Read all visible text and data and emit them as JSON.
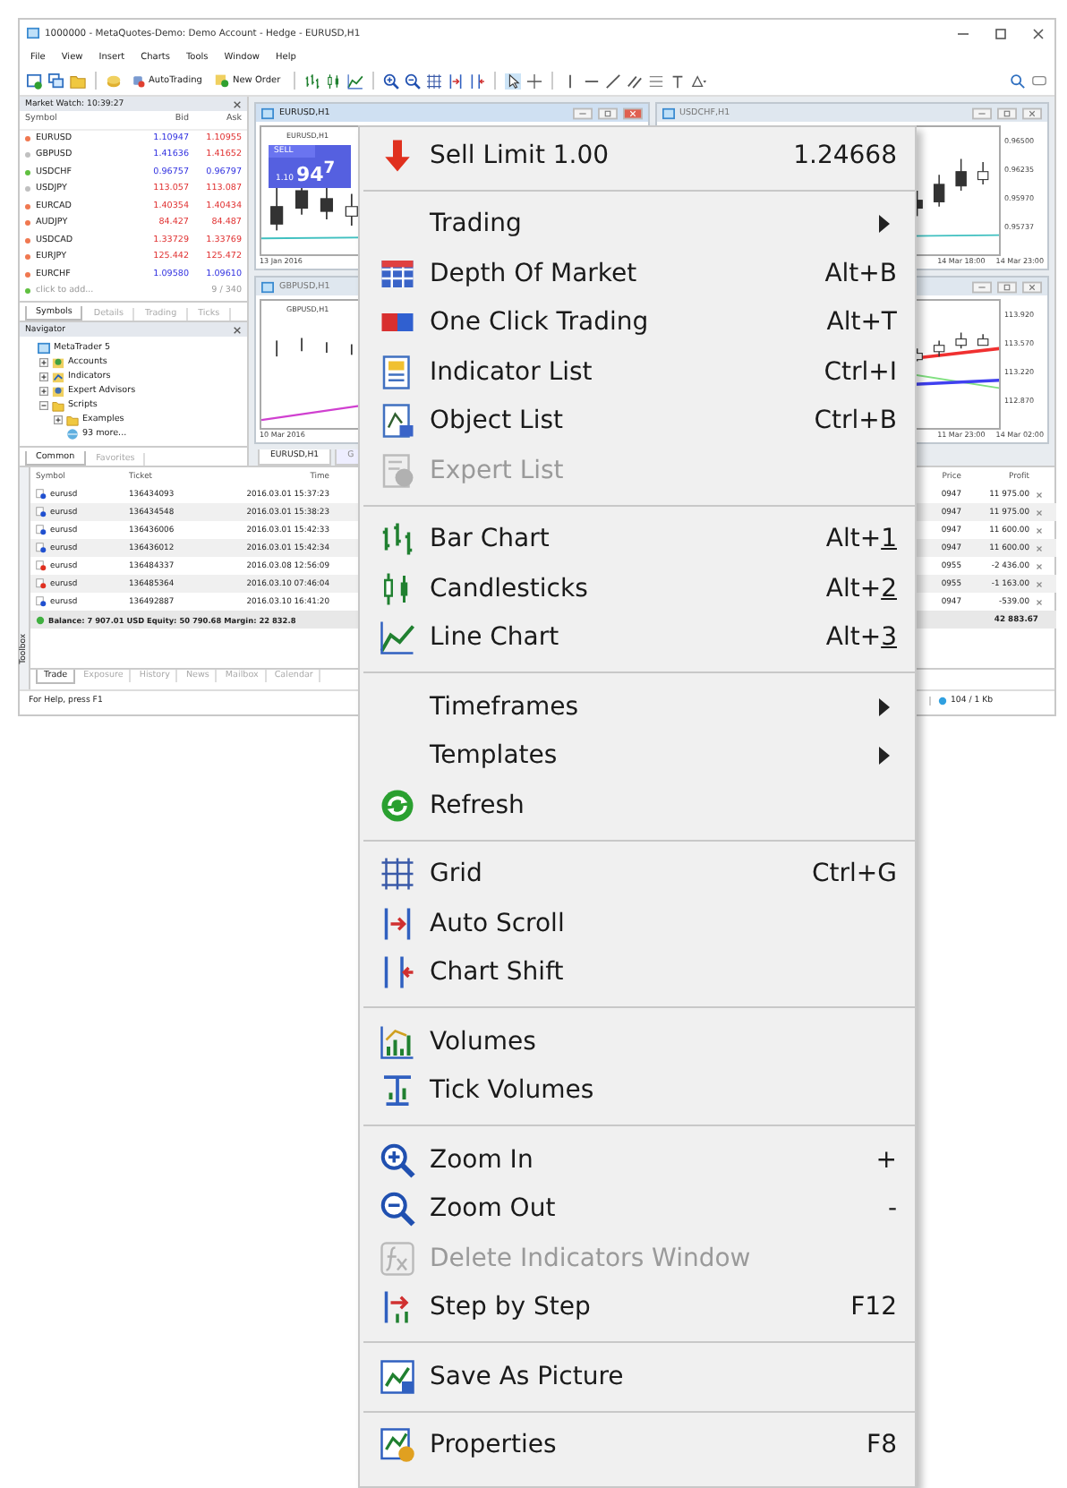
{
  "window": {
    "title": "1000000 - MetaQuotes-Demo: Demo Account - Hedge - EURUSD,H1"
  },
  "menu_bar": [
    "File",
    "View",
    "Insert",
    "Charts",
    "Tools",
    "Window",
    "Help"
  ],
  "toolbar": {
    "buttons": [
      {
        "label": "AutoTrading"
      },
      {
        "label": "New Order"
      }
    ]
  },
  "market_watch": {
    "title": "Market Watch: 10:39:27",
    "columns": [
      "Symbol",
      "Bid",
      "Ask"
    ],
    "rows": [
      {
        "symbol": "EURUSD",
        "bid": "1.10947",
        "ask": "1.10955",
        "color": "#f07850",
        "bid_up": true,
        "ask_up": false
      },
      {
        "symbol": "GBPUSD",
        "bid": "1.41636",
        "ask": "1.41652",
        "color": "#c0c0c0",
        "bid_up": true,
        "ask_up": false
      },
      {
        "symbol": "USDCHF",
        "bid": "0.96757",
        "ask": "0.96797",
        "color": "#60c040",
        "bid_up": true,
        "ask_up": true
      },
      {
        "symbol": "USDJPY",
        "bid": "113.057",
        "ask": "113.087",
        "color": "#c0c0c0",
        "bid_up": false,
        "ask_up": false
      },
      {
        "symbol": "EURCAD",
        "bid": "1.40354",
        "ask": "1.40434",
        "color": "#f07850",
        "bid_up": false,
        "ask_up": false
      },
      {
        "symbol": "AUDJPY",
        "bid": "84.427",
        "ask": "84.487",
        "color": "#f07850",
        "bid_up": false,
        "ask_up": false
      },
      {
        "symbol": "USDCAD",
        "bid": "1.33729",
        "ask": "1.33769",
        "color": "#f07850",
        "bid_up": false,
        "ask_up": false
      },
      {
        "symbol": "EURJPY",
        "bid": "125.442",
        "ask": "125.472",
        "color": "#f07850",
        "bid_up": false,
        "ask_up": false
      },
      {
        "symbol": "EURCHF",
        "bid": "1.09580",
        "ask": "1.09610",
        "color": "#f07850",
        "bid_up": true,
        "ask_up": true
      }
    ],
    "add_label": "click to add...",
    "count": "9 / 340",
    "tabs": [
      {
        "label": "Symbols",
        "selected": true
      },
      {
        "label": "Details",
        "selected": false
      },
      {
        "label": "Trading",
        "selected": false
      },
      {
        "label": "Ticks",
        "selected": false
      }
    ]
  },
  "navigator": {
    "title": "Navigator",
    "tree": [
      {
        "label": "MetaTrader 5",
        "kind": "root",
        "children": [
          {
            "label": "Accounts",
            "kind": "accounts",
            "expanded": false
          },
          {
            "label": "Indicators",
            "kind": "indicators",
            "expanded": false
          },
          {
            "label": "Expert Advisors",
            "kind": "experts",
            "expanded": false
          },
          {
            "label": "Scripts",
            "kind": "scripts",
            "expanded": true,
            "children": [
              {
                "label": "Examples",
                "kind": "scripts",
                "expanded": false
              },
              {
                "label": "93 more...",
                "kind": "market"
              }
            ]
          }
        ]
      }
    ],
    "tabs": [
      {
        "label": "Common",
        "selected": true
      },
      {
        "label": "Favorites",
        "selected": false
      }
    ]
  },
  "charts": [
    {
      "title": "EURUSD,H1",
      "active": true,
      "inner_label": "EURUSD,H1",
      "sell_label": "SELL",
      "sell_price": "1.10",
      "sell_pips": "94$^{7}$",
      "time_labels": [
        "13 Jan 2016"
      ]
    },
    {
      "title": "USDCHF,H1",
      "active": false,
      "price_labels": [
        "0.96500",
        "0.96235",
        "0.95970",
        "0.95737"
      ],
      "time_labels": [
        "14 Mar 18:00",
        "14 Mar 23:00"
      ]
    },
    {
      "title": "GBPUSD,H1",
      "active": false,
      "inner_label": "GBPUSD,H1",
      "time_labels": [
        "10 Mar 2016"
      ]
    },
    {
      "active": false,
      "price_labels": [
        "113.920",
        "113.570",
        "113.220",
        "112.870"
      ],
      "time_labels": [
        "11 Mar 23:00",
        "14 Mar 02:00"
      ]
    }
  ],
  "chart_tabs": [
    {
      "label": "EURUSD,H1",
      "selected": true
    },
    {
      "label": "G",
      "selected": false
    }
  ],
  "terminal": {
    "side_label": "Toolbox",
    "columns": [
      "Symbol",
      "Ticket",
      "Time",
      "Price",
      "Profit"
    ],
    "rows": [
      {
        "symbol": "eurusd",
        "sell": false,
        "ticket": "136434093",
        "time": "2016.03.01 15:37:23",
        "price": "0947",
        "profit": "11 975.00"
      },
      {
        "symbol": "eurusd",
        "sell": false,
        "ticket": "136434548",
        "time": "2016.03.01 15:38:23",
        "price": "0947",
        "profit": "11 975.00"
      },
      {
        "symbol": "eurusd",
        "sell": false,
        "ticket": "136436006",
        "time": "2016.03.01 15:42:33",
        "price": "0947",
        "profit": "11 600.00"
      },
      {
        "symbol": "eurusd",
        "sell": false,
        "ticket": "136436012",
        "time": "2016.03.01 15:42:34",
        "price": "0947",
        "profit": "11 600.00"
      },
      {
        "symbol": "eurusd",
        "sell": true,
        "ticket": "136484337",
        "time": "2016.03.08 12:56:09",
        "price": "0955",
        "profit": "-2 436.00"
      },
      {
        "symbol": "eurusd",
        "sell": true,
        "ticket": "136485364",
        "time": "2016.03.10 07:46:04",
        "price": "0955",
        "profit": "-1 163.00"
      },
      {
        "symbol": "eurusd",
        "sell": false,
        "ticket": "136492887",
        "time": "2016.03.10 16:41:20",
        "price": "0947",
        "profit": "-539.00"
      }
    ],
    "summary": "Balance: 7 907.01 USD  Equity: 50 790.68  Margin: 22 832.8",
    "total": "42 883.67",
    "tabs": [
      {
        "label": "Trade",
        "selected": true
      },
      {
        "label": "Exposure",
        "selected": false
      },
      {
        "label": "History",
        "selected": false
      },
      {
        "label": "News",
        "selected": false
      },
      {
        "label": "Mailbox",
        "selected": false
      },
      {
        "label": "Calendar",
        "selected": false
      }
    ]
  },
  "status_bar": {
    "help": "For Help, press F1",
    "traffic": "104 / 1 Kb"
  },
  "context_menu": {
    "items": [
      {
        "kind": "command",
        "label": "Sell Limit 1.00",
        "shortcut": "1.24668",
        "disabled": false
      },
      {
        "kind": "separator"
      },
      {
        "kind": "submenu",
        "label": "Trading",
        "disabled": false
      },
      {
        "kind": "command",
        "label": "Depth Of Market",
        "shortcut": "Alt+B",
        "disabled": false
      },
      {
        "kind": "command",
        "label": "One Click Trading",
        "shortcut": "Alt+T",
        "disabled": false
      },
      {
        "kind": "command",
        "label": "Indicator List",
        "shortcut": "Ctrl+I",
        "disabled": false
      },
      {
        "kind": "command",
        "label": "Object List",
        "shortcut": "Ctrl+B",
        "disabled": false
      },
      {
        "kind": "command",
        "label": "Expert List",
        "disabled": true
      },
      {
        "kind": "separator"
      },
      {
        "kind": "command",
        "label": "Bar Chart",
        "shortcut": "Alt+",
        "access_key": "1",
        "disabled": false
      },
      {
        "kind": "command",
        "label": "Candlesticks",
        "shortcut": "Alt+",
        "access_key": "2",
        "disabled": false
      },
      {
        "kind": "command",
        "label": "Line Chart",
        "shortcut": "Alt+",
        "access_key": "3",
        "disabled": false
      },
      {
        "kind": "separator"
      },
      {
        "kind": "submenu",
        "label": "Timeframes",
        "disabled": false
      },
      {
        "kind": "submenu",
        "label": "Templates",
        "disabled": false
      },
      {
        "kind": "command",
        "label": "Refresh",
        "disabled": false
      },
      {
        "kind": "separator"
      },
      {
        "kind": "command",
        "label": "Grid",
        "shortcut": "Ctrl+G",
        "disabled": false
      },
      {
        "kind": "command",
        "label": "Auto Scroll",
        "disabled": false
      },
      {
        "kind": "command",
        "label": "Chart Shift",
        "disabled": false
      },
      {
        "kind": "separator"
      },
      {
        "kind": "command",
        "label": "Volumes",
        "disabled": false
      },
      {
        "kind": "command",
        "label": "Tick Volumes",
        "disabled": false
      },
      {
        "kind": "separator"
      },
      {
        "kind": "command",
        "label": "Zoom In",
        "shortcut": "+",
        "disabled": false
      },
      {
        "kind": "command",
        "label": "Zoom Out",
        "shortcut": "-",
        "disabled": false
      },
      {
        "kind": "command",
        "label": "Delete Indicators Window",
        "disabled": true
      },
      {
        "kind": "command",
        "label": "Step by Step",
        "shortcut": "F12",
        "disabled": false
      },
      {
        "kind": "separator"
      },
      {
        "kind": "command",
        "label": "Save As Picture",
        "disabled": false
      },
      {
        "kind": "separator"
      },
      {
        "kind": "command",
        "label": "Properties",
        "shortcut": "F8",
        "disabled": false
      }
    ]
  }
}
